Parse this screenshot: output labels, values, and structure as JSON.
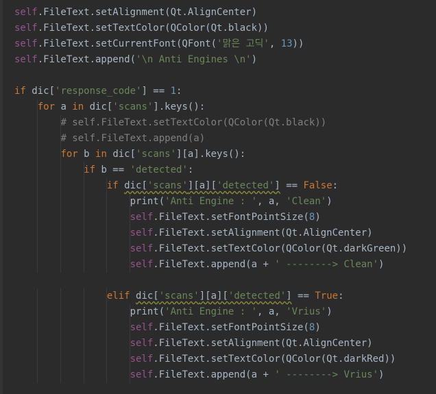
{
  "editor": {
    "lines": [
      [
        [
          "slf",
          "self"
        ],
        [
          "p",
          ".FileText.setAlignment(Qt.AlignCenter)"
        ]
      ],
      [
        [
          "slf",
          "self"
        ],
        [
          "p",
          ".FileText.setTextColor(QColor(Qt.black))"
        ]
      ],
      [
        [
          "slf",
          "self"
        ],
        [
          "p",
          ".FileText.setCurrentFont(QFont("
        ],
        [
          "s",
          "'맑은 고딕'"
        ],
        [
          "p",
          ", "
        ],
        [
          "n",
          "13"
        ],
        [
          "p",
          "))"
        ]
      ],
      [
        [
          "slf",
          "self"
        ],
        [
          "p",
          ".FileText.append("
        ],
        [
          "s",
          "'\\n Anti Engines \\n'"
        ],
        [
          "p",
          ")"
        ]
      ],
      [],
      [
        [
          "k",
          "if "
        ],
        [
          "p",
          "dic["
        ],
        [
          "s",
          "'response_code'"
        ],
        [
          "p",
          "] == "
        ],
        [
          "n",
          "1"
        ],
        [
          "p",
          ":"
        ]
      ],
      [
        [
          "p",
          "    "
        ],
        [
          "k",
          "for "
        ],
        [
          "p",
          "a "
        ],
        [
          "k",
          "in "
        ],
        [
          "p",
          "dic["
        ],
        [
          "s",
          "'scans'"
        ],
        [
          "p",
          "].keys():"
        ]
      ],
      [
        [
          "p",
          "        "
        ],
        [
          "c",
          "# self.FileText.setTextColor(QColor(Qt.black))"
        ]
      ],
      [
        [
          "p",
          "        "
        ],
        [
          "c",
          "# self.FileText.append(a)"
        ]
      ],
      [
        [
          "p",
          "        "
        ],
        [
          "k",
          "for "
        ],
        [
          "p",
          "b "
        ],
        [
          "k",
          "in "
        ],
        [
          "p",
          "dic["
        ],
        [
          "s",
          "'scans'"
        ],
        [
          "p",
          "][a].keys():"
        ]
      ],
      [
        [
          "p",
          "            "
        ],
        [
          "k",
          "if "
        ],
        [
          "p",
          "b == "
        ],
        [
          "s",
          "'detected'"
        ],
        [
          "p",
          ":"
        ]
      ],
      [
        [
          "p",
          "                "
        ],
        [
          "k",
          "if "
        ],
        [
          "pw",
          "dic["
        ],
        [
          "sw",
          "'scans'"
        ],
        [
          "pw",
          "][a]["
        ],
        [
          "sw",
          "'detected'"
        ],
        [
          "pw",
          "]"
        ],
        [
          "p",
          " == "
        ],
        [
          "k",
          "False"
        ],
        [
          "p",
          ":"
        ]
      ],
      [
        [
          "p",
          "                    print("
        ],
        [
          "s",
          "'Anti Engine : '"
        ],
        [
          "p",
          ", a, "
        ],
        [
          "s",
          "'Clean'"
        ],
        [
          "p",
          ")"
        ]
      ],
      [
        [
          "p",
          "                    "
        ],
        [
          "slf",
          "self"
        ],
        [
          "p",
          ".FileText.setFontPointSize("
        ],
        [
          "n",
          "8"
        ],
        [
          "p",
          ")"
        ]
      ],
      [
        [
          "p",
          "                    "
        ],
        [
          "slf",
          "self"
        ],
        [
          "p",
          ".FileText.setAlignment(Qt.AlignCenter)"
        ]
      ],
      [
        [
          "p",
          "                    "
        ],
        [
          "slf",
          "self"
        ],
        [
          "p",
          ".FileText.setTextColor(QColor(Qt.darkGreen))"
        ]
      ],
      [
        [
          "p",
          "                    "
        ],
        [
          "slf",
          "self"
        ],
        [
          "p",
          ".FileText.append(a + "
        ],
        [
          "s",
          "' --------> Clean'"
        ],
        [
          "p",
          ")"
        ]
      ],
      [],
      [
        [
          "p",
          "                "
        ],
        [
          "k",
          "elif "
        ],
        [
          "pw",
          "dic["
        ],
        [
          "sw",
          "'scans'"
        ],
        [
          "pw",
          "][a]["
        ],
        [
          "sw",
          "'detected'"
        ],
        [
          "pw",
          "]"
        ],
        [
          "p",
          " == "
        ],
        [
          "k",
          "True"
        ],
        [
          "p",
          ":"
        ]
      ],
      [
        [
          "p",
          "                    print("
        ],
        [
          "s",
          "'Anti Engine : '"
        ],
        [
          "p",
          ", a, "
        ],
        [
          "s",
          "'Vrius'"
        ],
        [
          "p",
          ")"
        ]
      ],
      [
        [
          "p",
          "                    "
        ],
        [
          "slf",
          "self"
        ],
        [
          "p",
          ".FileText.setFontPointSize("
        ],
        [
          "n",
          "8"
        ],
        [
          "p",
          ")"
        ]
      ],
      [
        [
          "p",
          "                    "
        ],
        [
          "slf",
          "self"
        ],
        [
          "p",
          ".FileText.setAlignment(Qt.AlignCenter)"
        ]
      ],
      [
        [
          "p",
          "                    "
        ],
        [
          "slf",
          "self"
        ],
        [
          "p",
          ".FileText.setTextColor(QColor(Qt.darkRed))"
        ]
      ],
      [
        [
          "p",
          "                    "
        ],
        [
          "slf",
          "self"
        ],
        [
          "p",
          ".FileText.append(a + "
        ],
        [
          "s",
          "' --------> Vrius'"
        ],
        [
          "p",
          ")"
        ]
      ]
    ]
  }
}
